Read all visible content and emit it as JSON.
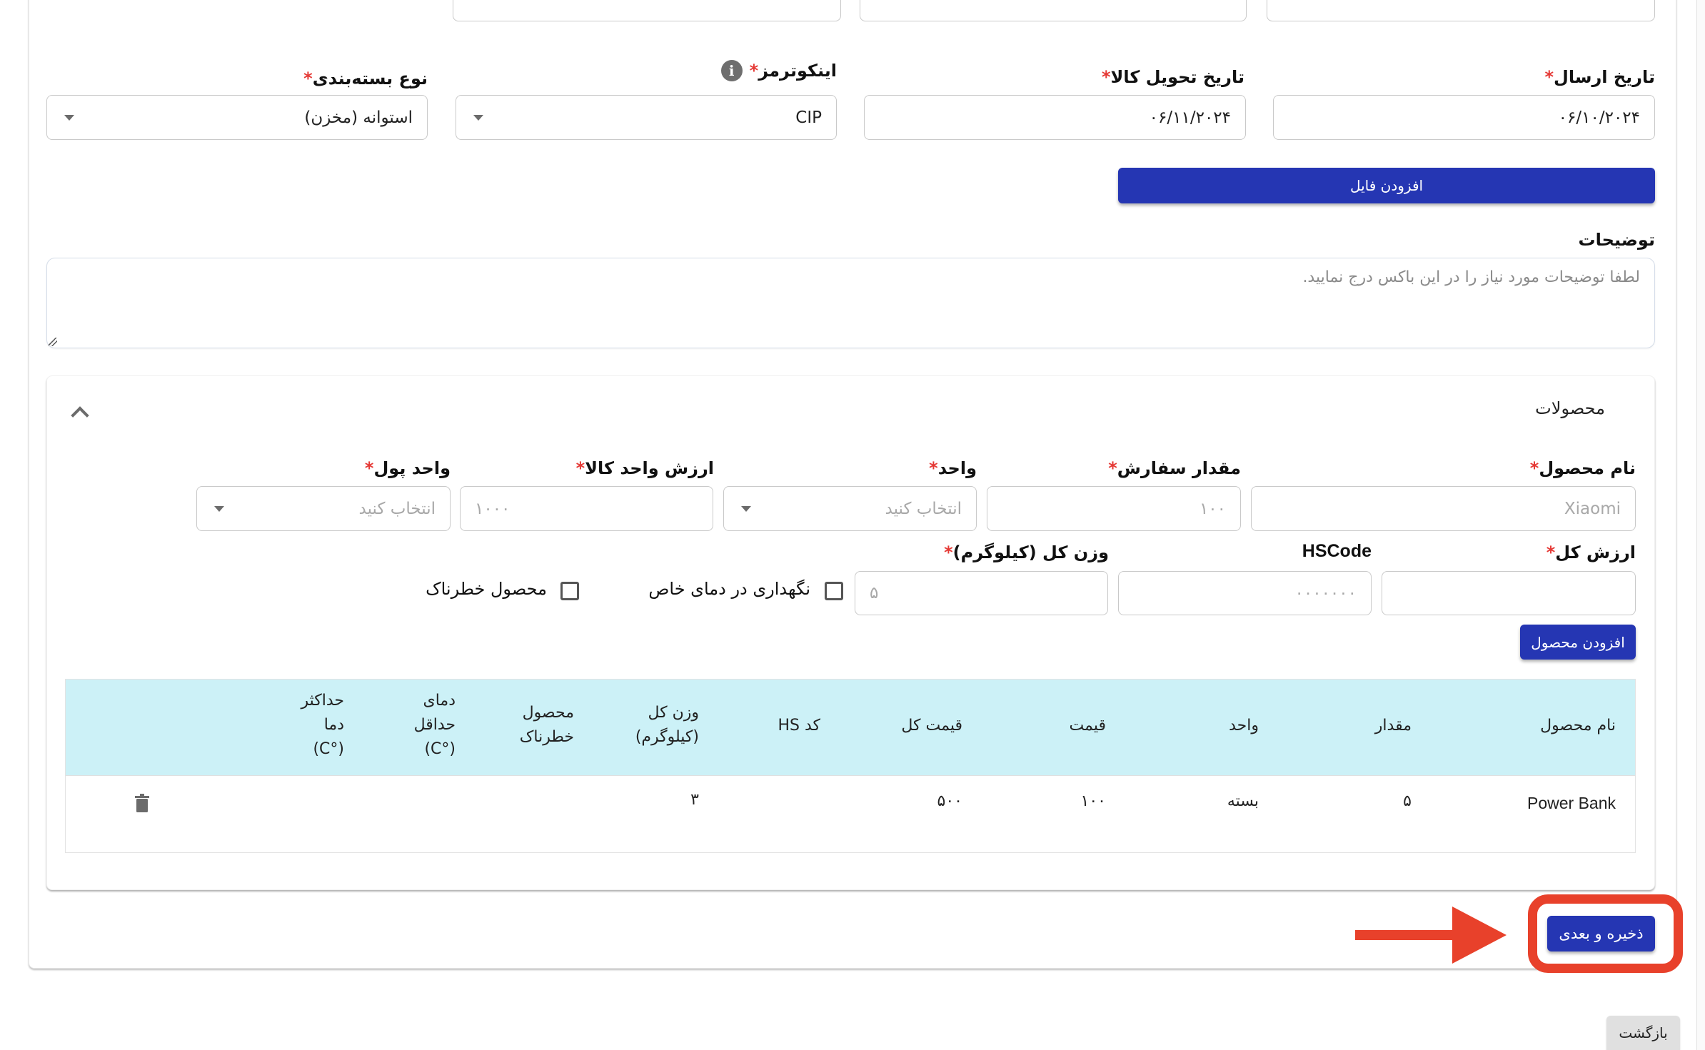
{
  "shipping": {
    "send_date": {
      "label": "تاریخ ارسال",
      "value": "۰۶/۱۰/۲۰۲۴"
    },
    "delivery_date": {
      "label": "تاریخ تحویل کالا",
      "value": "۰۶/۱۱/۲۰۲۴"
    },
    "incoterms": {
      "label": "اینکوترمز",
      "value": "CIP",
      "info_icon": "info-icon"
    },
    "packaging": {
      "label": "نوع بسته‌بندی",
      "value": "استوانه (مخزن)"
    },
    "required_mark": "*",
    "add_file_label": "افزودن فایل"
  },
  "description": {
    "label": "توضیحات",
    "placeholder": "لطفا توضیحات مورد نیاز را در این باکس درج نمایید."
  },
  "products": {
    "title": "محصولات",
    "collapse_icon": "chevron-up-icon",
    "form": {
      "product_name": {
        "label": "نام محصول",
        "placeholder": "Xiaomi"
      },
      "order_qty": {
        "label": "مقدار سفارش",
        "placeholder": "۱۰۰"
      },
      "unit": {
        "label": "واحد",
        "placeholder": "انتخاب کنید"
      },
      "unit_value": {
        "label": "ارزش واحد کالا",
        "placeholder": "۱۰۰۰"
      },
      "currency": {
        "label": "واحد پول",
        "placeholder": "انتخاب کنید"
      },
      "total_value": {
        "label": "ارزش کل",
        "value": ""
      },
      "hscode": {
        "label": "HSCode",
        "placeholder": "۰۰۰۰۰۰۰"
      },
      "total_weight": {
        "label": "وزن کل (کیلوگرم)",
        "placeholder": "۵"
      },
      "special_temp": {
        "label": "نگهداری در دمای خاص",
        "checked": false
      },
      "dangerous": {
        "label": "محصول خطرناک",
        "checked": false
      },
      "add_product_label": "افزودن محصول"
    },
    "table": {
      "columns": [
        "نام محصول",
        "مقدار",
        "واحد",
        "قیمت",
        "قیمت کل",
        "کد HS",
        [
          "وزن کل",
          "(کیلوگرم)"
        ],
        [
          "محصول",
          "خطرناک"
        ],
        [
          "دمای",
          "حداقل",
          "(°C)"
        ],
        [
          "حداکثر",
          "دما",
          "(°C)"
        ]
      ],
      "rows": [
        {
          "name": "Power Bank",
          "qty": "۵",
          "unit": "بسته",
          "price": "۱۰۰",
          "total_price": "۵۰۰",
          "hs_code": "",
          "weight": "۳",
          "dangerous": "",
          "min_temp": "",
          "max_temp": "",
          "action_icon": "trash-icon"
        }
      ]
    }
  },
  "actions": {
    "save_next_label": "ذخیره و بعدی",
    "back_label": "بازگشت"
  },
  "annotation": {
    "color": "#e8412b",
    "highlight_target": "save-next-button"
  },
  "colors": {
    "primary": "#2536b3",
    "table_header": "#ccf1f7",
    "required": "#e53935"
  }
}
